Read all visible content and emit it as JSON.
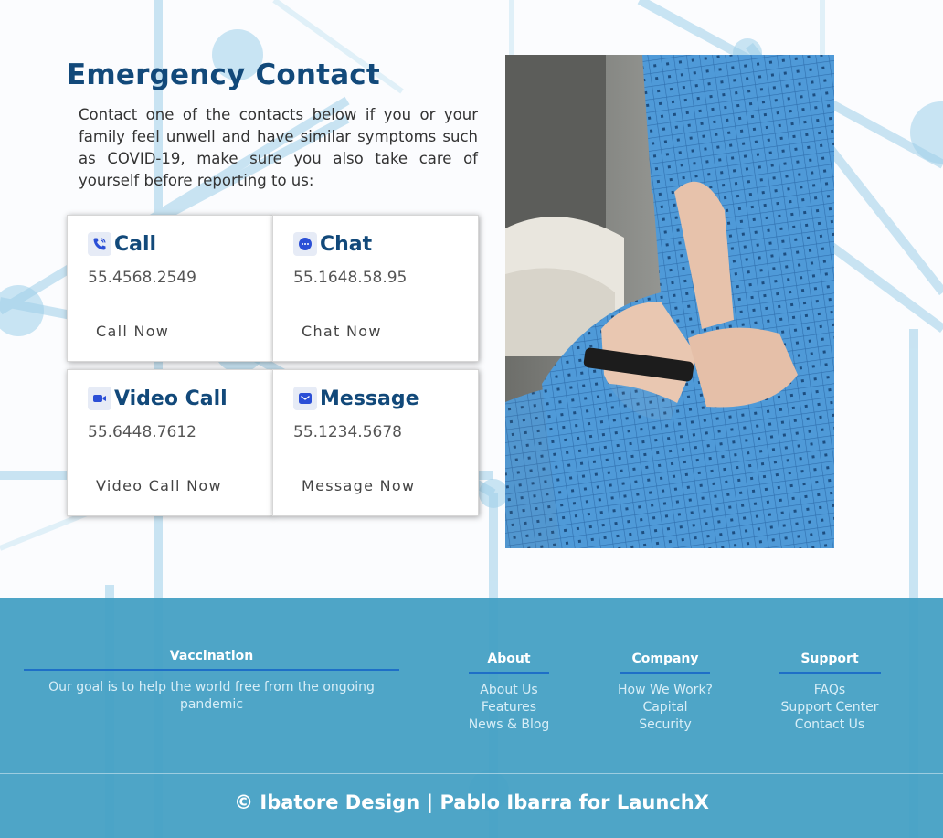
{
  "main": {
    "title": "Emergency Contact",
    "intro": "Contact one of the contacts below if you or your family feel unwell and have similar symptoms such as COVID-19, make sure you also take care of yourself before reporting to us:"
  },
  "cards": {
    "call": {
      "title": "Call",
      "number": "55.4568.2549",
      "cta": "Call Now",
      "icon": "phone-icon"
    },
    "chat": {
      "title": "Chat",
      "number": "55.1648.58.95",
      "cta": "Chat Now",
      "icon": "chat-bubble-icon"
    },
    "video": {
      "title": "Video Call",
      "number": "55.6448.7612",
      "cta": "Video Call Now",
      "icon": "video-camera-icon"
    },
    "message": {
      "title": "Message",
      "number": "55.1234.5678",
      "cta": "Message Now",
      "icon": "envelope-icon"
    }
  },
  "photo": {
    "subject": "patient-holding-phone-photo"
  },
  "footer": {
    "vaccination": {
      "heading": "Vaccination",
      "text": "Our goal is to help the world free from the ongoing pandemic"
    },
    "about": {
      "heading": "About",
      "links": [
        "About Us",
        "Features",
        "News & Blog"
      ]
    },
    "company": {
      "heading": "Company",
      "links": [
        "How We Work?",
        "Capital",
        "Security"
      ]
    },
    "support": {
      "heading": "Support",
      "links": [
        "FAQs",
        "Support Center",
        "Contact Us"
      ]
    },
    "copyright": "© Ibatore Design | Pablo Ibarra for LaunchX"
  },
  "colors": {
    "accent": "#12497a",
    "footer_bg": "#44a0c4",
    "underline": "#1e6fc7",
    "icon_blue": "#2b4fd6"
  }
}
